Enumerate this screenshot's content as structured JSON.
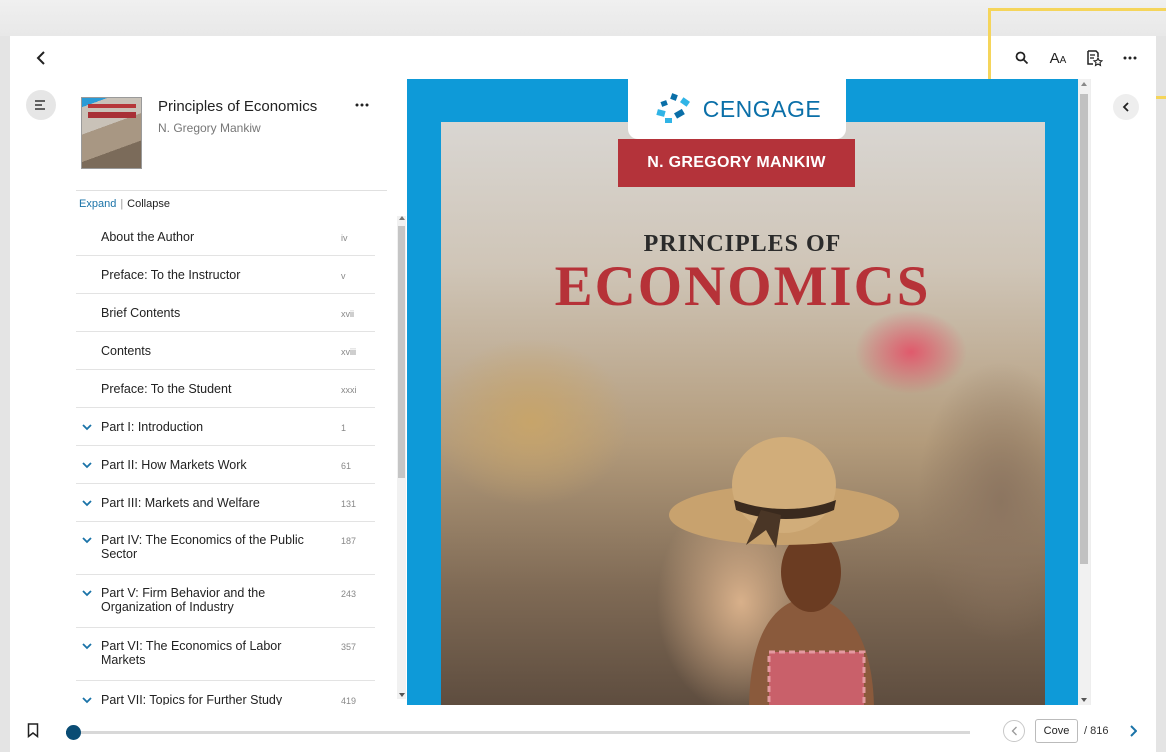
{
  "header": {
    "back_icon": "chevron-left-icon",
    "tools": [
      {
        "name": "search-icon",
        "label": "Search"
      },
      {
        "name": "font-size-icon",
        "label": "Text size"
      },
      {
        "name": "bookmark-star-icon",
        "label": "Bookmarks"
      },
      {
        "name": "more-options-icon",
        "label": "More"
      }
    ],
    "font_tool_glyph": "A"
  },
  "sidebar": {
    "book_title": "Principles of Economics",
    "book_author": "N. Gregory Mankiw",
    "expand_label": "Expand",
    "separator": "|",
    "collapse_label": "Collapse",
    "toc": [
      {
        "label": "About the Author",
        "page": "iv",
        "expandable": false
      },
      {
        "label": "Preface: To the Instructor",
        "page": "v",
        "expandable": false
      },
      {
        "label": "Brief Contents",
        "page": "xvii",
        "expandable": false
      },
      {
        "label": "Contents",
        "page": "xviii",
        "expandable": false
      },
      {
        "label": "Preface: To the Student",
        "page": "xxxi",
        "expandable": false
      },
      {
        "label": "Part I: Introduction",
        "page": "1",
        "expandable": true
      },
      {
        "label": "Part II: How Markets Work",
        "page": "61",
        "expandable": true
      },
      {
        "label": "Part III: Markets and Welfare",
        "page": "131",
        "expandable": true
      },
      {
        "label": "Part IV: The Economics of the Public Sector",
        "page": "187",
        "expandable": true
      },
      {
        "label": "Part V: Firm Behavior and the Organization of Industry",
        "page": "243",
        "expandable": true
      },
      {
        "label": "Part VI: The Economics of Labor Markets",
        "page": "357",
        "expandable": true
      },
      {
        "label": "Part VII: Topics for Further Study",
        "page": "419",
        "expandable": true
      }
    ]
  },
  "cover": {
    "publisher": "CENGAGE",
    "author": "N. GREGORY MANKIW",
    "title_line1": "PRINCIPLES OF",
    "title_line2": "ECONOMICS"
  },
  "footer": {
    "page_value": "Cove",
    "page_total": "/ 816",
    "progress_fraction": 0.01
  },
  "colors": {
    "accent": "#0a4c74",
    "highlight": "#f5d55b",
    "cover_blue": "#0e9ad8",
    "cover_red": "#b4333a"
  }
}
